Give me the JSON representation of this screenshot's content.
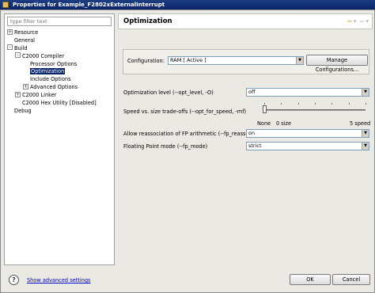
{
  "window": {
    "title": "Properties for Example_F2802xExternalInterrupt"
  },
  "filter": {
    "placeholder": "type filter text"
  },
  "tree": {
    "items": [
      {
        "label": "Resource",
        "expander": "+",
        "level": 0
      },
      {
        "label": "General",
        "expander": "",
        "level": 0
      },
      {
        "label": "Build",
        "expander": "-",
        "level": 0
      },
      {
        "label": "C2000 Compiler",
        "expander": "-",
        "level": 1
      },
      {
        "label": "Processor Options",
        "expander": "",
        "level": 2
      },
      {
        "label": "Optimization",
        "expander": "",
        "level": 2,
        "selected": true
      },
      {
        "label": "Include Options",
        "expander": "",
        "level": 2
      },
      {
        "label": "Advanced Options",
        "expander": "+",
        "level": 2
      },
      {
        "label": "C2000 Linker",
        "expander": "+",
        "level": 1
      },
      {
        "label": "C2000 Hex Utility  [Disabled]",
        "expander": "",
        "level": 1
      },
      {
        "label": "Debug",
        "expander": "",
        "level": 0
      }
    ]
  },
  "page": {
    "title": "Optimization",
    "nav": {
      "back": "⇦",
      "back_menu": "▾",
      "forward": "⇨",
      "forward_menu": "▾"
    }
  },
  "configuration": {
    "label": "Configuration:",
    "value": "RAM  [ Active ]",
    "manage_button": "Manage Configurations..."
  },
  "settings": {
    "opt_level": {
      "label": "Optimization level (--opt_level, -O)",
      "value": "off"
    },
    "speed": {
      "label": "Speed vs. size trade-offs (--opt_for_speed, -mf)",
      "value": 0,
      "min": 0,
      "max": 5,
      "tick_labels": {
        "none": "None",
        "zero": "0 size",
        "five": "5 speed"
      }
    },
    "fp_reassoc": {
      "label": "Allow reassociation of FP arithmetic (--fp_reassoc)",
      "value": "on"
    },
    "fp_mode": {
      "label": "Floating Point mode (--fp_mode)",
      "value": "strict"
    }
  },
  "footer": {
    "help_icon": "?",
    "advanced_link": "Show advanced settings",
    "ok": "OK",
    "cancel": "Cancel"
  }
}
